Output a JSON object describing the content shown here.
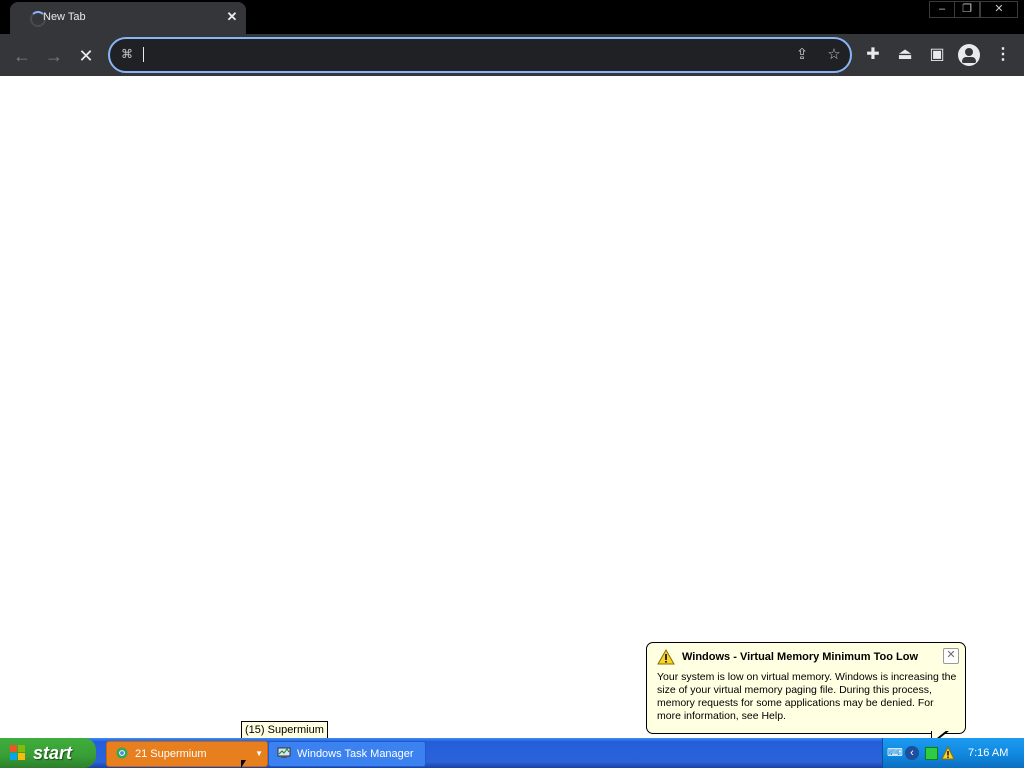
{
  "browser": {
    "tab": {
      "title": "New Tab",
      "close_icon": "close-icon"
    },
    "window_controls": {
      "minimize": "minimize-icon",
      "restore": "restore-icon",
      "close": "close-icon"
    },
    "toolbar": {
      "back": "back-arrow-icon",
      "forward": "forward-arrow-icon",
      "stop": "stop-icon",
      "omnibox": {
        "value": "",
        "placeholder": ""
      },
      "share": "share-icon",
      "bookmark": "star-icon",
      "extensions": "puzzle-icon",
      "labs": "flask-icon",
      "side_panel": "side-panel-icon",
      "profile": "profile-icon",
      "menu": "more-vert-icon"
    },
    "accent": "#8ab4f8"
  },
  "taskbar": {
    "start_label": "start",
    "buttons": [
      {
        "label": "21  Supermium",
        "icon": "browser-icon"
      },
      {
        "label": "Windows Task Manager",
        "icon": "task-manager-icon"
      }
    ],
    "tooltip": "(15) Supermium",
    "clock": "7:16 AM",
    "tray_icons": [
      "keyboard-icon",
      "sound-icon",
      "network-icon",
      "warning-icon"
    ]
  },
  "balloon": {
    "title": "Windows - Virtual Memory Minimum Too Low",
    "body": "Your system is low on virtual memory. Windows is increasing the size of your virtual memory paging file. During this process, memory requests for some applications may be denied. For more information, see Help."
  }
}
